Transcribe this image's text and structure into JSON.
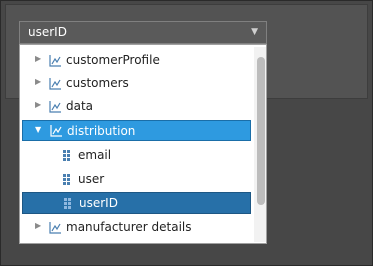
{
  "combo": {
    "value": "userID"
  },
  "tree": {
    "items": [
      {
        "label": "customerProfile",
        "type": "dimension",
        "expanded": false
      },
      {
        "label": "customers",
        "type": "dimension",
        "expanded": false
      },
      {
        "label": "data",
        "type": "dimension",
        "expanded": false
      },
      {
        "label": "distribution",
        "type": "dimension",
        "expanded": true,
        "state": "highlighted"
      },
      {
        "label": "email",
        "type": "attribute"
      },
      {
        "label": "user",
        "type": "attribute"
      },
      {
        "label": "userID",
        "type": "attribute",
        "state": "selected"
      },
      {
        "label": "manufacturer details",
        "type": "dimension",
        "expanded": false
      }
    ]
  },
  "colors": {
    "highlight": "#2e9ae0",
    "selected": "#2770a8",
    "background": "#474747"
  },
  "icons": {
    "collapsed": "triangle-right-icon",
    "expanded": "triangle-down-icon",
    "dimension": "hierarchy-icon",
    "attribute": "grid-dots-icon"
  }
}
